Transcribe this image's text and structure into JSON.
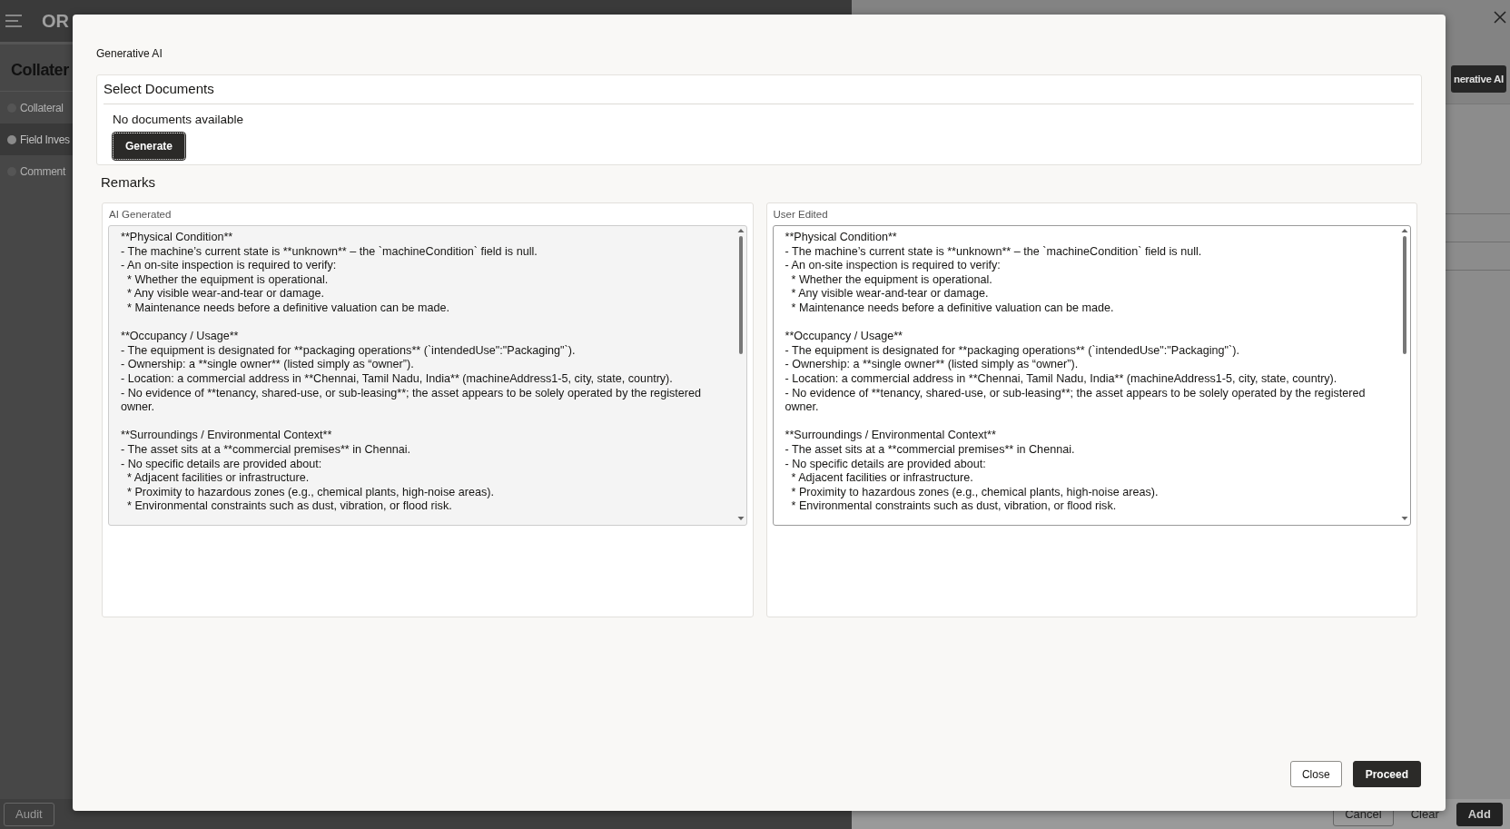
{
  "background": {
    "logo": "OR",
    "page_title": "Collater",
    "steps": [
      {
        "label": "Collateral",
        "selected": false
      },
      {
        "label": "Field Inves",
        "selected": true
      },
      {
        "label": "Comment",
        "selected": false
      }
    ],
    "footer_buttons": [
      {
        "label": "Audit",
        "kind": "secondary"
      }
    ],
    "panel": {
      "generative_ai_button": "nerative AI",
      "footer_buttons": [
        {
          "label": "Cancel",
          "kind": "secondary"
        },
        {
          "label": "Clear",
          "kind": "plain"
        },
        {
          "label": "Add",
          "kind": "primary"
        }
      ]
    }
  },
  "dialog": {
    "title": "Generative AI",
    "select_documents": {
      "heading": "Select Documents",
      "message": "No documents available",
      "generate_button": "Generate"
    },
    "remarks": {
      "heading": "Remarks",
      "panels": [
        {
          "label": "AI Generated",
          "readonly": true,
          "text": "**Physical Condition**\n- The machine’s current state is **unknown** – the `machineCondition` field is null.\n- An on-site inspection is required to verify:\n  * Whether the equipment is operational.\n  * Any visible wear-and-tear or damage.\n  * Maintenance needs before a definitive valuation can be made.\n\n**Occupancy / Usage**\n- The equipment is designated for **packaging operations** (`intendedUse\":\"Packaging\"`).\n- Ownership: a **single owner** (listed simply as “owner”).\n- Location: a commercial address in **Chennai, Tamil Nadu, India** (machineAddress1-5, city, state, country).\n- No evidence of **tenancy, shared-use, or sub-leasing**; the asset appears to be solely operated by the registered owner.\n\n**Surroundings / Environmental Context**\n- The asset sits at a **commercial premises** in Chennai.\n- No specific details are provided about:\n  * Adjacent facilities or infrastructure.\n  * Proximity to hazardous zones (e.g., chemical plants, high-noise areas).\n  * Environmental constraints such as dust, vibration, or flood risk."
        },
        {
          "label": "User Edited",
          "readonly": false,
          "text": "**Physical Condition**\n- The machine’s current state is **unknown** – the `machineCondition` field is null.\n- An on-site inspection is required to verify:\n  * Whether the equipment is operational.\n  * Any visible wear-and-tear or damage.\n  * Maintenance needs before a definitive valuation can be made.\n\n**Occupancy / Usage**\n- The equipment is designated for **packaging operations** (`intendedUse\":\"Packaging\"`).\n- Ownership: a **single owner** (listed simply as “owner”).\n- Location: a commercial address in **Chennai, Tamil Nadu, India** (machineAddress1-5, city, state, country).\n- No evidence of **tenancy, shared-use, or sub-leasing**; the asset appears to be solely operated by the registered owner.\n\n**Surroundings / Environmental Context**\n- The asset sits at a **commercial premises** in Chennai.\n- No specific details are provided about:\n  * Adjacent facilities or infrastructure.\n  * Proximity to hazardous zones (e.g., chemical plants, high-noise areas).\n  * Environmental constraints such as dust, vibration, or flood risk."
        }
      ]
    },
    "buttons": [
      {
        "label": "Close",
        "kind": "secondary"
      },
      {
        "label": "Proceed",
        "kind": "primary"
      }
    ]
  }
}
